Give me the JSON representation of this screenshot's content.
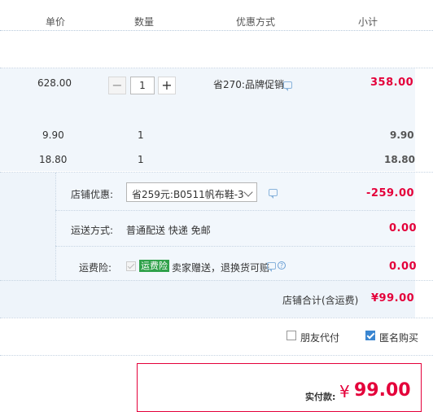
{
  "header": {
    "col_price": "单价",
    "col_qty": "数量",
    "col_promo": "优惠方式",
    "col_subtotal": "小计"
  },
  "items": [
    {
      "price": "628.00",
      "qty": "1",
      "promo": "省270:品牌促销",
      "subtotal": "358.00",
      "subtotal_color": "#e4003a",
      "stepper_minus": "−",
      "stepper_plus": "+"
    },
    {
      "price": "9.90",
      "qty": "1",
      "subtotal": "9.90"
    },
    {
      "price": "18.80",
      "qty": "1",
      "subtotal": "18.80"
    }
  ],
  "shop": {
    "discount_label": "店铺优惠:",
    "discount_selected": "省259元:B0511帆布鞋-3",
    "discount_amount": "-259.00",
    "shipping_label": "运送方式:",
    "shipping_value": "普通配送 快递 免邮",
    "shipping_amount": "0.00",
    "insurance_label": "运费险:",
    "insurance_badge": "运费险",
    "insurance_text": "卖家赠送，退换货可赔",
    "insurance_amount": "0.00",
    "total_label": "店铺合计(含运费)",
    "total_value": "¥99.00"
  },
  "options": {
    "friend_pay": "朋友代付",
    "friend_pay_checked": false,
    "anonymous": "匿名购买",
    "anonymous_checked": true
  },
  "payment": {
    "label": "实付款:",
    "currency": "¥",
    "amount": "99.00"
  },
  "colors": {
    "accent_red": "#e4003a",
    "accent_blue": "#3a86d1",
    "badge_green": "#2fa14a"
  },
  "icons": {
    "chat": "chat-bubble-icon",
    "help": "question-circle-icon",
    "dropdown": "chevron-down-icon"
  }
}
